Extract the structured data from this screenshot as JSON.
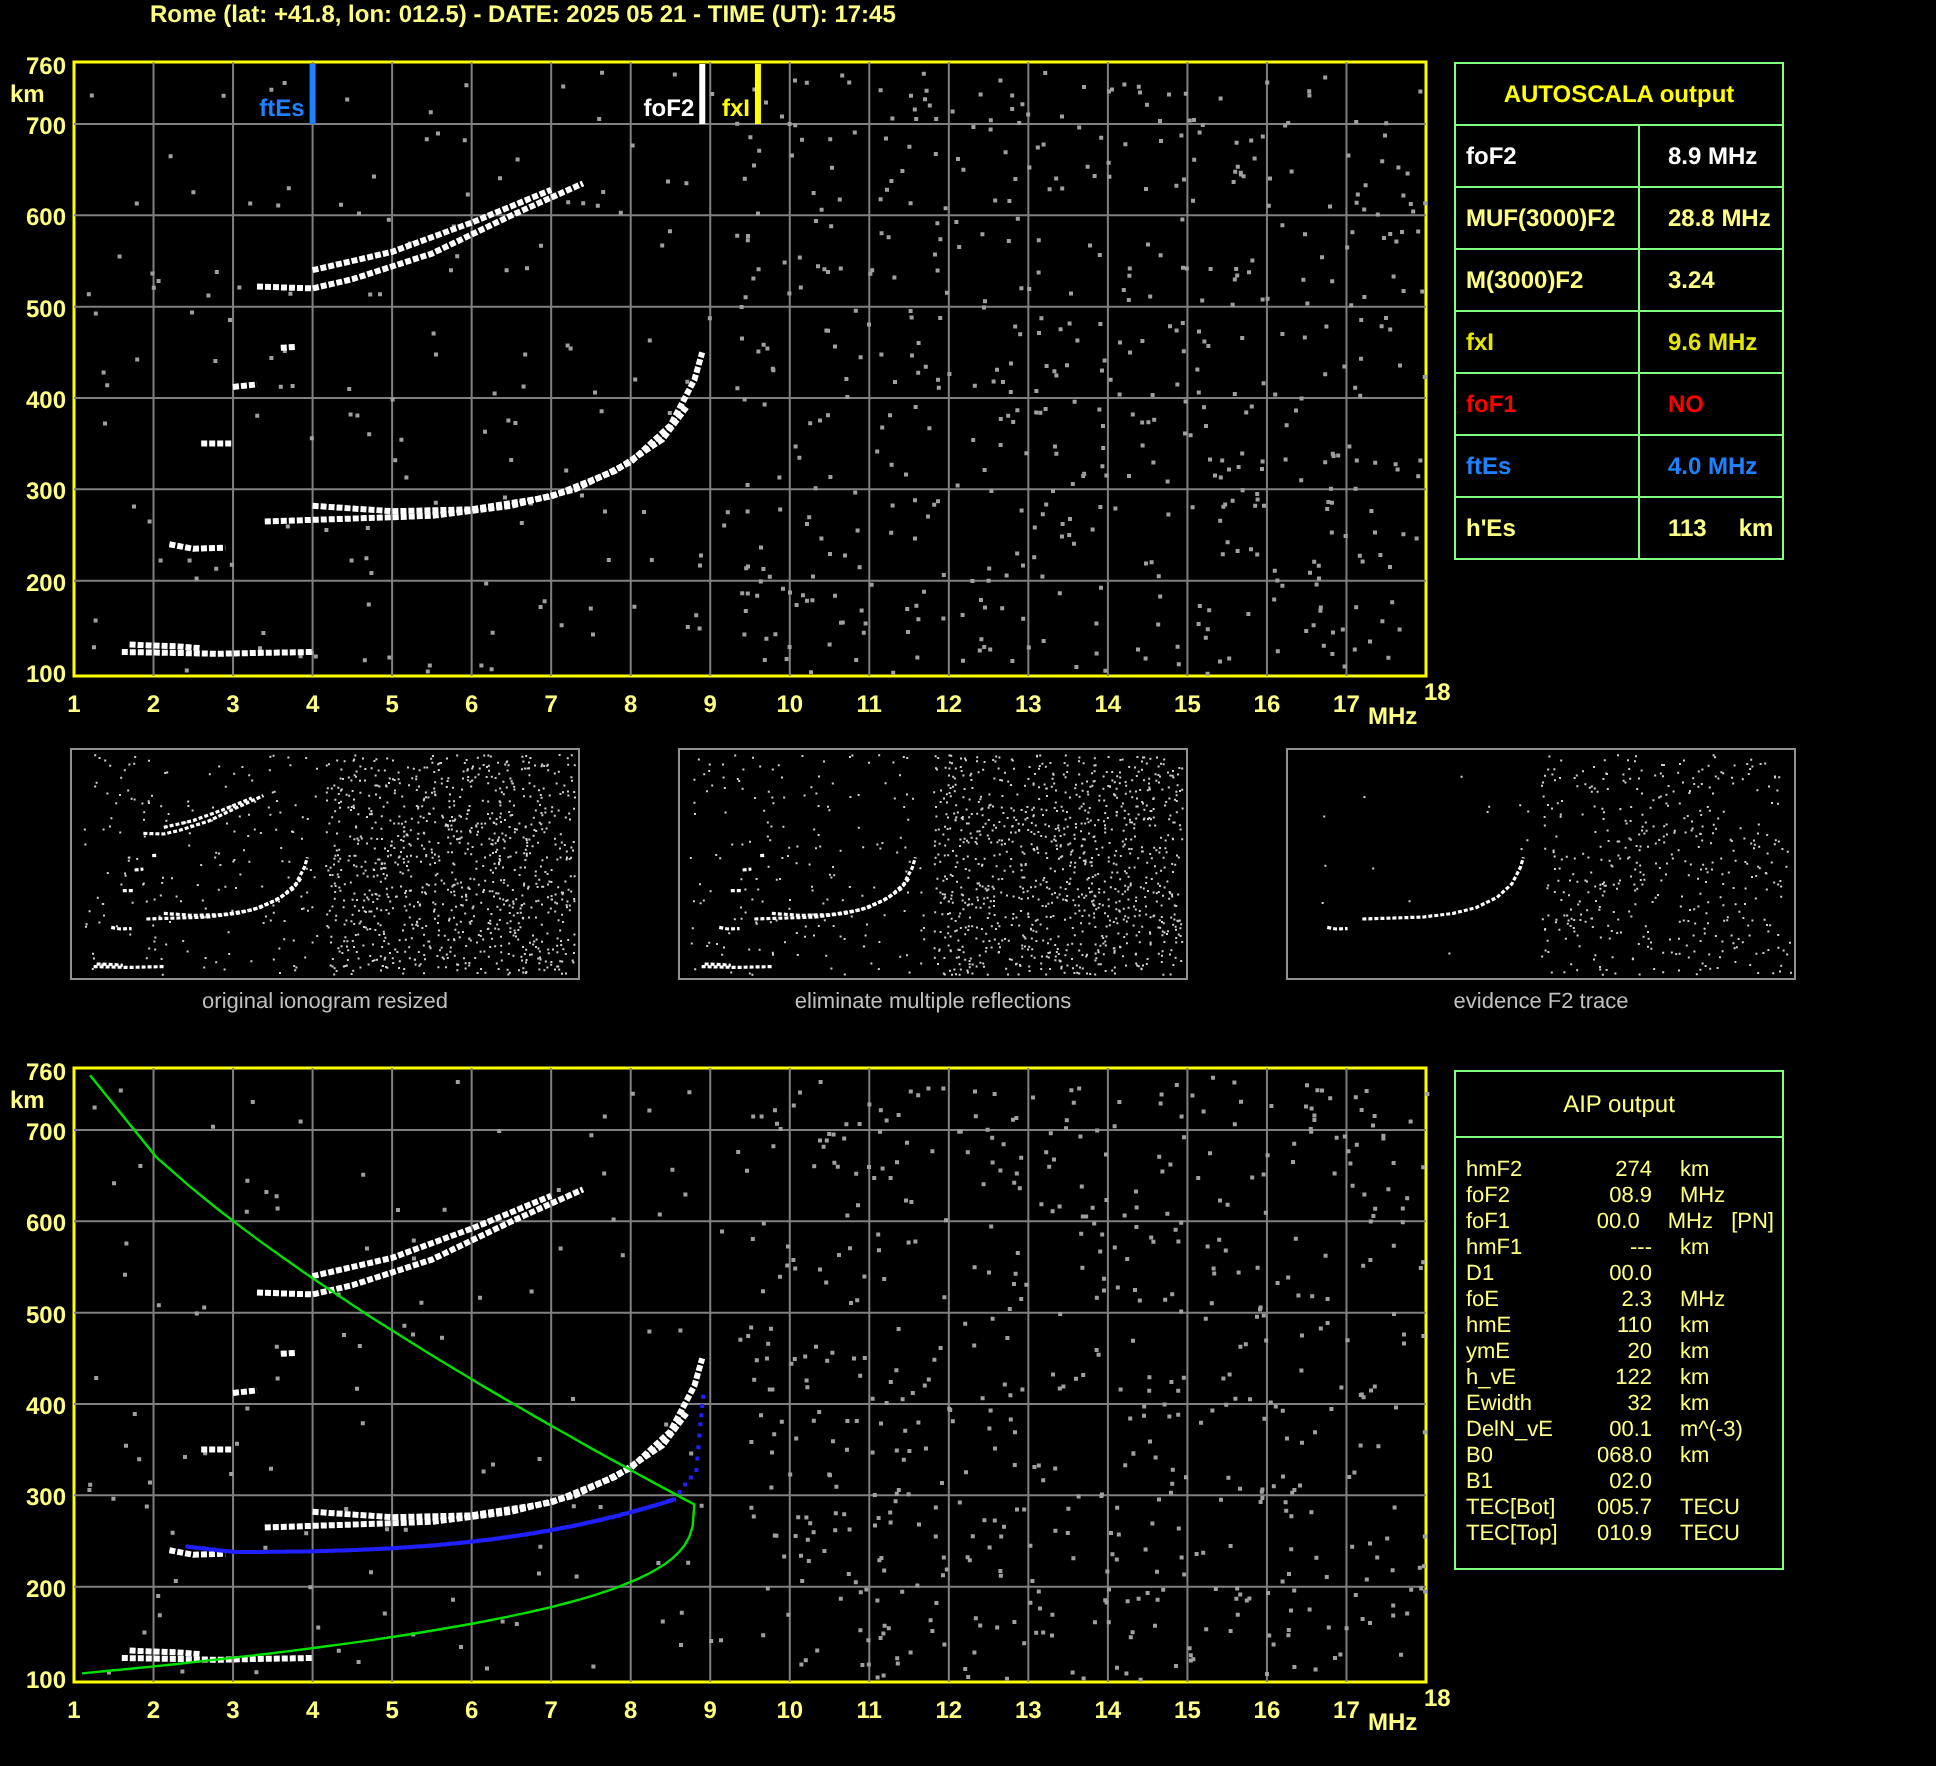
{
  "title": "Rome (lat: +41.8, lon: 012.5) - DATE: 2025 05 21 - TIME (UT): 17:45",
  "ionogram": {
    "y_unit": "km",
    "x_unit": "MHz",
    "y_labels": [
      "760",
      "700",
      "600",
      "500",
      "400",
      "300",
      "200",
      "100"
    ],
    "x_labels": [
      "1",
      "2",
      "3",
      "4",
      "5",
      "6",
      "7",
      "8",
      "9",
      "10",
      "11",
      "12",
      "13",
      "14",
      "15",
      "16",
      "17",
      "18"
    ],
    "markers": [
      {
        "label": "ftEs",
        "color": "#1e82ff"
      },
      {
        "label": "foF2",
        "color": "#ffffff"
      },
      {
        "label": "fxI",
        "color": "#ffff00"
      }
    ]
  },
  "autoscala": {
    "title": "AUTOSCALA output",
    "rows": [
      {
        "label": "foF2",
        "value": "8.9 MHz",
        "kind": "main"
      },
      {
        "label": "MUF(3000)F2",
        "value": "28.8 MHz",
        "kind": "derived"
      },
      {
        "label": "M(3000)F2",
        "value": "3.24",
        "kind": "derived"
      },
      {
        "label": "fxI",
        "value": "9.6 MHz",
        "kind": "limit"
      },
      {
        "label": "foF1",
        "value": "NO",
        "kind": "absent"
      },
      {
        "label": "ftEs",
        "value": "4.0 MHz",
        "kind": "sporadic"
      },
      {
        "label": "h'Es",
        "value": "113",
        "unit": "km",
        "kind": "derived"
      }
    ]
  },
  "thumbnails": [
    {
      "kind": "original",
      "caption": "original ionogram resized"
    },
    {
      "kind": "filtered",
      "caption": "eliminate multiple reflections"
    },
    {
      "kind": "trace",
      "caption": "evidence F2 trace"
    }
  ],
  "profile_ionogram": {
    "y_unit": "km",
    "x_unit": "MHz",
    "y_labels": [
      "760",
      "700",
      "600",
      "500",
      "400",
      "300",
      "200",
      "100"
    ],
    "x_labels": [
      "1",
      "2",
      "3",
      "4",
      "5",
      "6",
      "7",
      "8",
      "9",
      "10",
      "11",
      "12",
      "13",
      "14",
      "15",
      "16",
      "17",
      "18"
    ]
  },
  "aip": {
    "title": "AIP output",
    "rows": [
      {
        "name": "hmF2",
        "value": "274",
        "unit": "km"
      },
      {
        "name": "foF2",
        "value": "08.9",
        "unit": "MHz"
      },
      {
        "name": "foF1",
        "value": "00.0",
        "unit": "MHz",
        "note": "[PN]"
      },
      {
        "name": "hmF1",
        "value": "---",
        "unit": "km"
      },
      {
        "name": "D1",
        "value": "00.0"
      },
      {
        "name": "foE",
        "value": "2.3",
        "unit": "MHz"
      },
      {
        "name": "hmE",
        "value": "110",
        "unit": "km"
      },
      {
        "name": "ymE",
        "value": "20",
        "unit": "km"
      },
      {
        "name": "h_vE",
        "value": "122",
        "unit": "km"
      },
      {
        "name": "Ewidth",
        "value": "32",
        "unit": "km"
      },
      {
        "name": "DelN_vE",
        "value": "00.1",
        "unit": "m^(-3)"
      },
      {
        "name": "B0",
        "value": "068.0",
        "unit": "km"
      },
      {
        "name": "B1",
        "value": "02.0"
      },
      {
        "name": "TEC[Bot]",
        "value": "005.7",
        "unit": "TECU"
      },
      {
        "name": "TEC[Top]",
        "value": "010.9",
        "unit": "TECU"
      }
    ]
  }
}
